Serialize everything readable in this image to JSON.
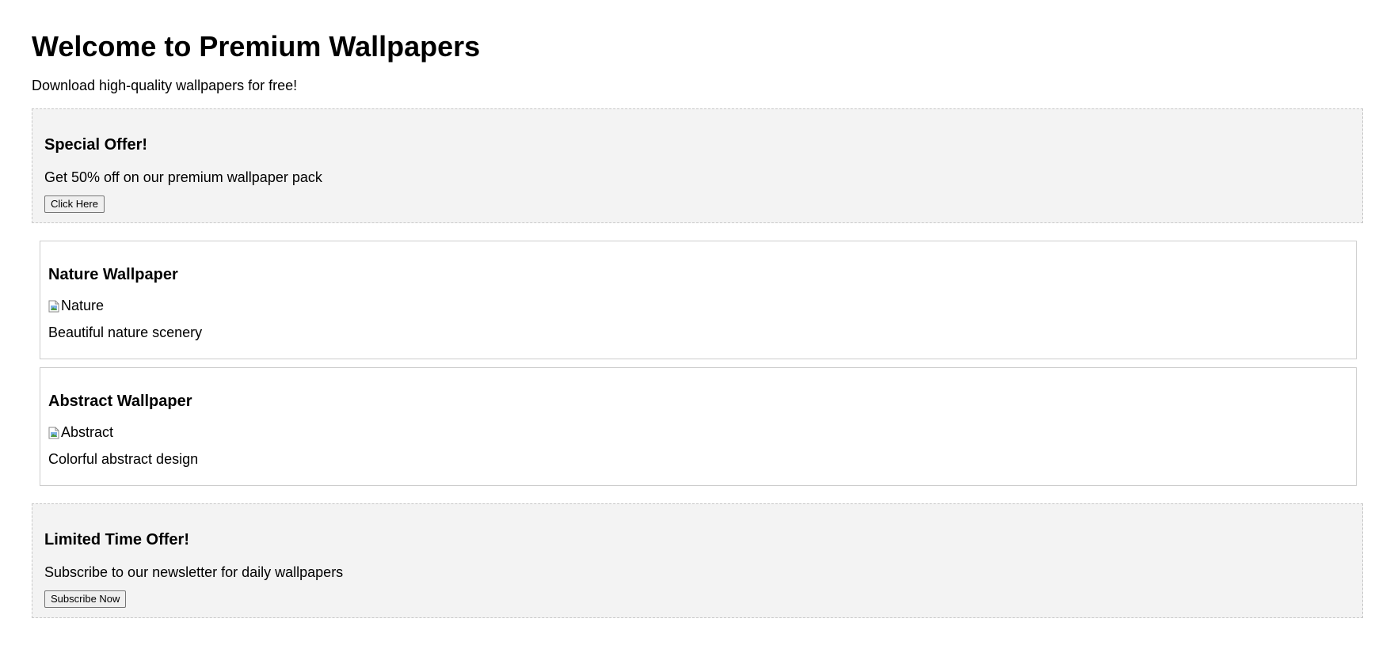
{
  "header": {
    "title": "Welcome to Premium Wallpapers",
    "subtitle": "Download high-quality wallpapers for free!"
  },
  "ads": {
    "top": {
      "title": "Special Offer!",
      "text": "Get 50% off on our premium wallpaper pack",
      "button_label": "Click Here"
    },
    "bottom": {
      "title": "Limited Time Offer!",
      "text": "Subscribe to our newsletter for daily wallpapers",
      "button_label": "Subscribe Now"
    }
  },
  "wallpapers": [
    {
      "title": "Nature Wallpaper",
      "image_alt": "Nature",
      "image_icon": "broken-image-icon",
      "description": "Beautiful nature scenery"
    },
    {
      "title": "Abstract Wallpaper",
      "image_alt": "Abstract",
      "image_icon": "broken-image-icon",
      "description": "Colorful abstract design"
    }
  ],
  "colors": {
    "ad_background": "#f3f3f3",
    "ad_border": "#c8c8c8",
    "card_border": "#cccccc"
  }
}
